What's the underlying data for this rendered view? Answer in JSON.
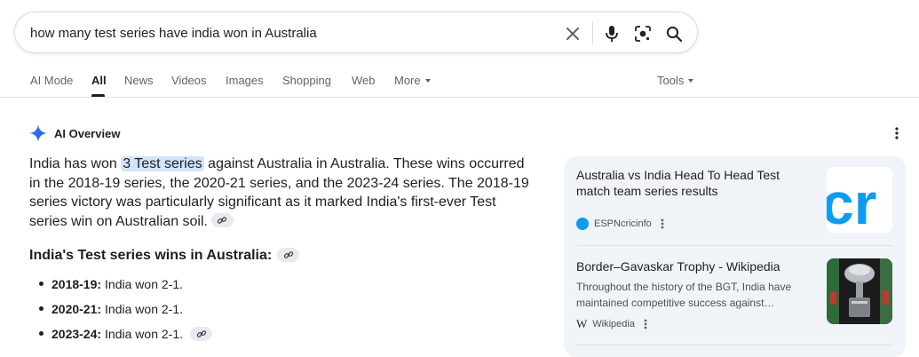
{
  "search": {
    "query": "how many test series have india won in Australia"
  },
  "tabs": [
    {
      "label": "AI Mode"
    },
    {
      "label": "All"
    },
    {
      "label": "News"
    },
    {
      "label": "Videos"
    },
    {
      "label": "Images"
    },
    {
      "label": "Shopping"
    },
    {
      "label": "Web"
    },
    {
      "label": "More"
    }
  ],
  "tools_label": "Tools",
  "ai_overview": {
    "label": "AI Overview",
    "summary_prefix": "India has won ",
    "summary_highlight": "3 Test series",
    "summary_rest": " against Australia in Australia. These wins occurred in the 2018-19 series, the 2020-21 series, and the 2023-24 series. The 2018-19 series victory was particularly significant as it marked India's first-ever Test series win on Australian soil.",
    "subheading": "India's Test series wins in Australia:",
    "bullets": [
      {
        "year": "2018-19:",
        "text": "India won 2-1."
      },
      {
        "year": "2020-21:",
        "text": "India won 2-1."
      },
      {
        "year": "2023-24:",
        "text": "India won 2-1."
      }
    ]
  },
  "sources": [
    {
      "title": "Australia vs India Head To Head Test match team series results",
      "site": "ESPNcricinfo",
      "thumb_text": "cr"
    },
    {
      "title": "Border–Gavaskar Trophy - Wikipedia",
      "snippet": "Throughout the history of the BGT, India have maintained competitive success against…",
      "site": "Wikipedia",
      "site_glyph": "W"
    }
  ],
  "colors": {
    "accent_blue": "#1a73e8",
    "highlight": "#d3e3fd",
    "panel_bg": "#f0f4f9",
    "espn_blue": "#0d9cf2"
  }
}
